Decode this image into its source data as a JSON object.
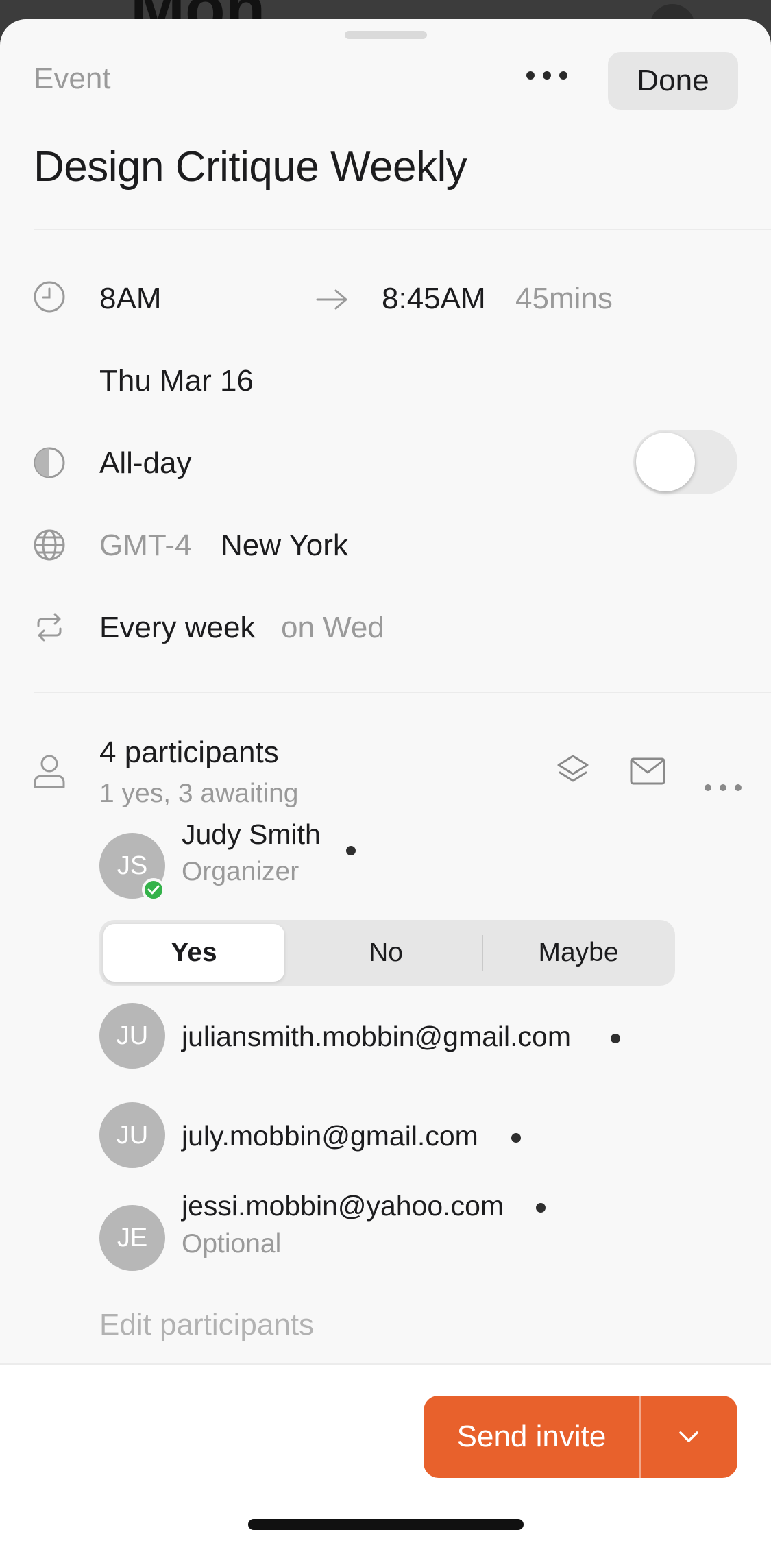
{
  "background": {
    "title": "Mon"
  },
  "header": {
    "kind_label": "Event",
    "more_icon": "more-horizontal-icon",
    "done_label": "Done"
  },
  "event": {
    "title": "Design Critique Weekly",
    "start_time": "8AM",
    "end_time": "8:45AM",
    "duration": "45mins",
    "date": "Thu Mar 16",
    "all_day_label": "All-day",
    "all_day_on": false,
    "timezone_offset": "GMT-4",
    "timezone_city": "New York",
    "repeat_label": "Every week",
    "repeat_detail": "on Wed"
  },
  "participants": {
    "title": "4 participants",
    "summary": "1 yes, 3 awaiting",
    "rsvp_options": [
      "Yes",
      "No",
      "Maybe"
    ],
    "rsvp_selected": "Yes",
    "edit_label": "Edit participants",
    "list": [
      {
        "initials": "JS",
        "name": "Judy Smith",
        "role": "Organizer",
        "accepted": true
      },
      {
        "initials": "JU",
        "name": "juliansmith.mobbin@gmail.com",
        "role": ""
      },
      {
        "initials": "JU",
        "name": "july.mobbin@gmail.com",
        "role": ""
      },
      {
        "initials": "JE",
        "name": "jessi.mobbin@yahoo.com",
        "role": "Optional"
      }
    ]
  },
  "footer": {
    "send_label": "Send invite"
  },
  "colors": {
    "accent": "#E8612C",
    "sheet_bg": "#F8F8F8",
    "accepted_badge": "#34B24A"
  }
}
